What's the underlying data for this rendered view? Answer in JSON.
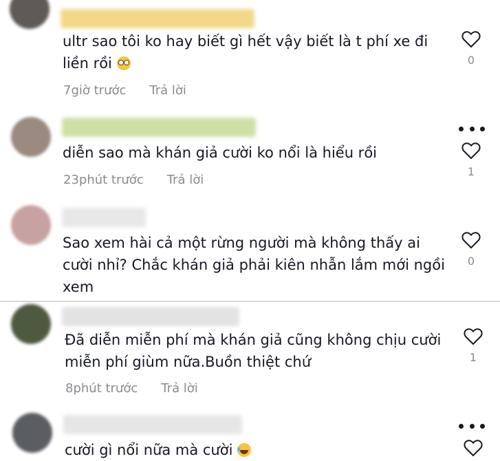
{
  "comments": [
    {
      "text": "ultr sao tôi ko hay biết gì hết vậy biết là t phí xe đi liền rồi",
      "emoji": "flushed-face-emoji",
      "time": "7giờ trước",
      "reply": "Trả lời",
      "likes": "0",
      "avatar_color": "#5e5a57",
      "username_color": "#f2d98a"
    },
    {
      "text": "diễn sao mà khán giả cười ko nổi là hiểu rồi",
      "time": "23phút trước",
      "reply": "Trả lời",
      "likes": "1",
      "avatar_color": "#9a8a7f",
      "username_color": "#cfe0a6"
    },
    {
      "text": "Sao xem hài cả một rừng người mà không thấy ai cười nhỉ? Chắc khán giả phải kiên nhẫn lắm mới ngồi xem",
      "likes": "0",
      "avatar_color": "#c6a2a2",
      "username_color": "#e8e8e8"
    },
    {
      "text": "Đã diễn miễn phí mà khán giả cũng không chịu cười miễn phí giùm nữa.Buồn thiệt chứ",
      "time": "8phút trước",
      "reply": "Trả lời",
      "likes": "1",
      "avatar_color": "#4e5a40",
      "username_color": "#e3e3e3"
    },
    {
      "text": "cười gì nổi nữa mà cười",
      "emoji": "laughing-tears-emoji",
      "avatar_color": "#5a5d62",
      "username_color": "#e6e6e6"
    }
  ],
  "colors": {
    "text": "#161823",
    "meta": "#8a8b91",
    "divider": "#d9d9db"
  }
}
